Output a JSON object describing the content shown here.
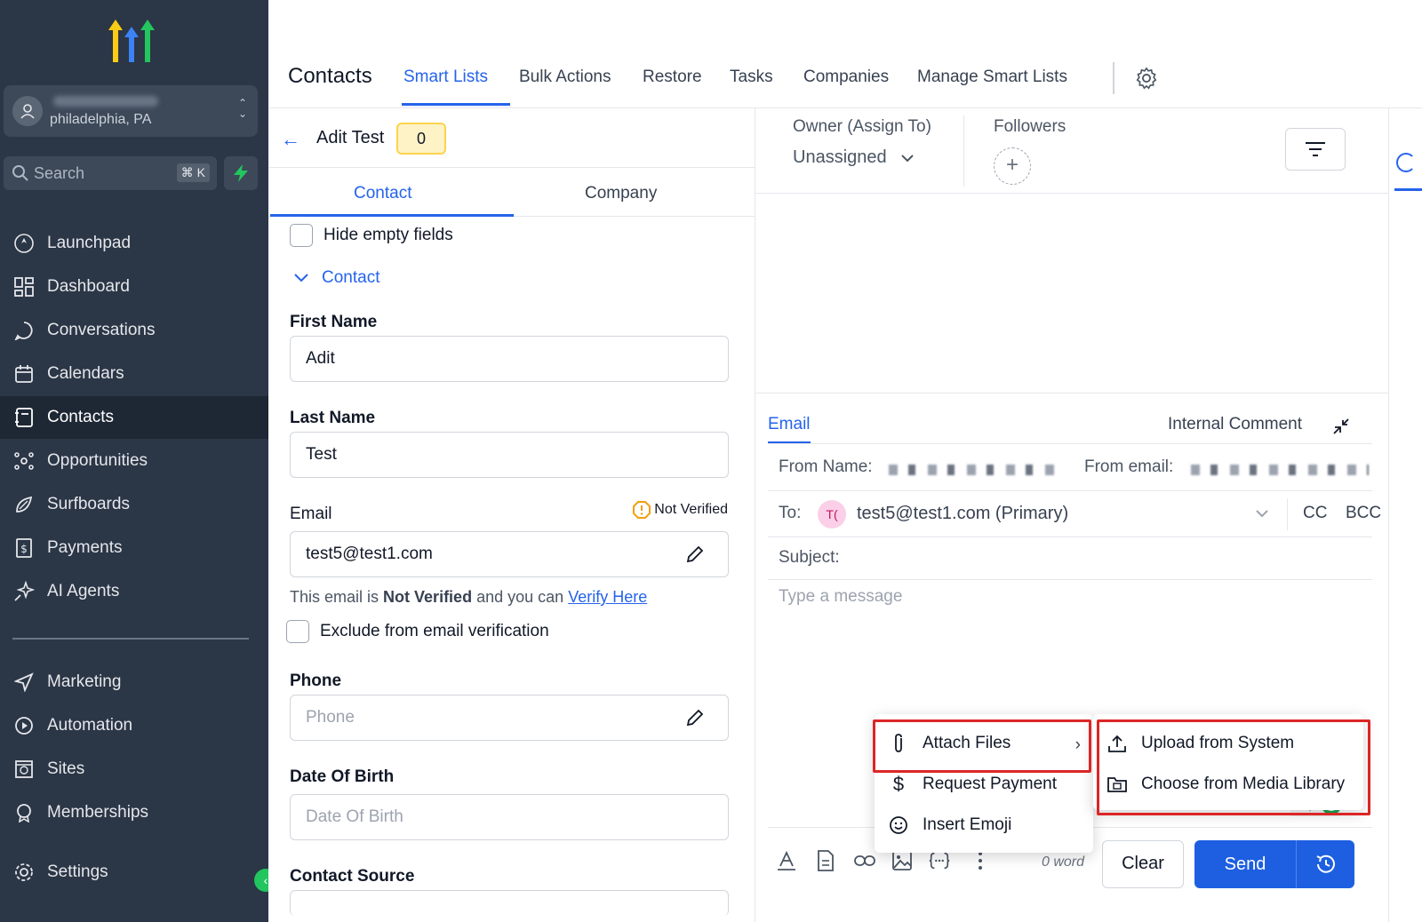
{
  "sidebar": {
    "account_location": "philadelphia, PA",
    "search_label": "Search",
    "search_shortcut": "⌘ K",
    "nav": [
      {
        "label": "Launchpad",
        "icon": "launchpad-icon"
      },
      {
        "label": "Dashboard",
        "icon": "dashboard-icon"
      },
      {
        "label": "Conversations",
        "icon": "chat-icon"
      },
      {
        "label": "Calendars",
        "icon": "calendar-icon"
      },
      {
        "label": "Contacts",
        "icon": "contacts-icon",
        "active": true
      },
      {
        "label": "Opportunities",
        "icon": "opportunities-icon"
      },
      {
        "label": "Surfboards",
        "icon": "surfboard-icon"
      },
      {
        "label": "Payments",
        "icon": "payments-icon"
      },
      {
        "label": "AI Agents",
        "icon": "sparkle-icon"
      }
    ],
    "nav2": [
      {
        "label": "Marketing",
        "icon": "send-icon"
      },
      {
        "label": "Automation",
        "icon": "automation-icon"
      },
      {
        "label": "Sites",
        "icon": "globe-icon"
      },
      {
        "label": "Memberships",
        "icon": "badge-icon"
      }
    ],
    "settings_label": "Settings"
  },
  "topbar": {
    "title": "Contacts",
    "tabs": [
      "Smart Lists",
      "Bulk Actions",
      "Restore",
      "Tasks",
      "Companies",
      "Manage Smart Lists"
    ],
    "active_tab": "Smart Lists"
  },
  "contact": {
    "name": "Adit Test",
    "badge_count": "0",
    "subtabs": [
      "Contact",
      "Company"
    ],
    "hide_empty_label": "Hide empty fields",
    "section_label": "Contact",
    "fields": {
      "first_name_label": "First Name",
      "first_name_value": "Adit",
      "last_name_label": "Last Name",
      "last_name_value": "Test",
      "email_label": "Email",
      "email_value": "test5@test1.com",
      "not_verified": "Not Verified",
      "verify_prefix": "This email is",
      "verify_bold": "Not Verified",
      "verify_mid": "and you can",
      "verify_link": "Verify Here",
      "exclude_label": "Exclude from email verification",
      "phone_label": "Phone",
      "phone_placeholder": "Phone",
      "dob_label": "Date Of Birth",
      "dob_placeholder": "Date Of Birth",
      "source_label": "Contact Source"
    }
  },
  "owner": {
    "label": "Owner (Assign To)",
    "value": "Unassigned",
    "followers_label": "Followers"
  },
  "composer": {
    "tab_email": "Email",
    "tab_comment": "Internal Comment",
    "from_name_label": "From Name:",
    "from_email_label": "From email:",
    "to_label": "To:",
    "to_avatar": "T(",
    "to_value": "test5@test1.com (Primary)",
    "cc": "CC",
    "bcc": "BCC",
    "subject_label": "Subject:",
    "message_placeholder": "Type a message",
    "word_count": "0 word",
    "clear": "Clear",
    "send": "Send"
  },
  "menu": {
    "items": [
      "Attach Files",
      "Request Payment",
      "Insert Emoji"
    ],
    "submenu": [
      "Upload from System",
      "Choose from Media Library"
    ]
  },
  "colors": {
    "sidebar_bg": "#2b3646",
    "accent": "#2563eb",
    "send": "#1d5fe0",
    "highlight": "#dc2626"
  }
}
